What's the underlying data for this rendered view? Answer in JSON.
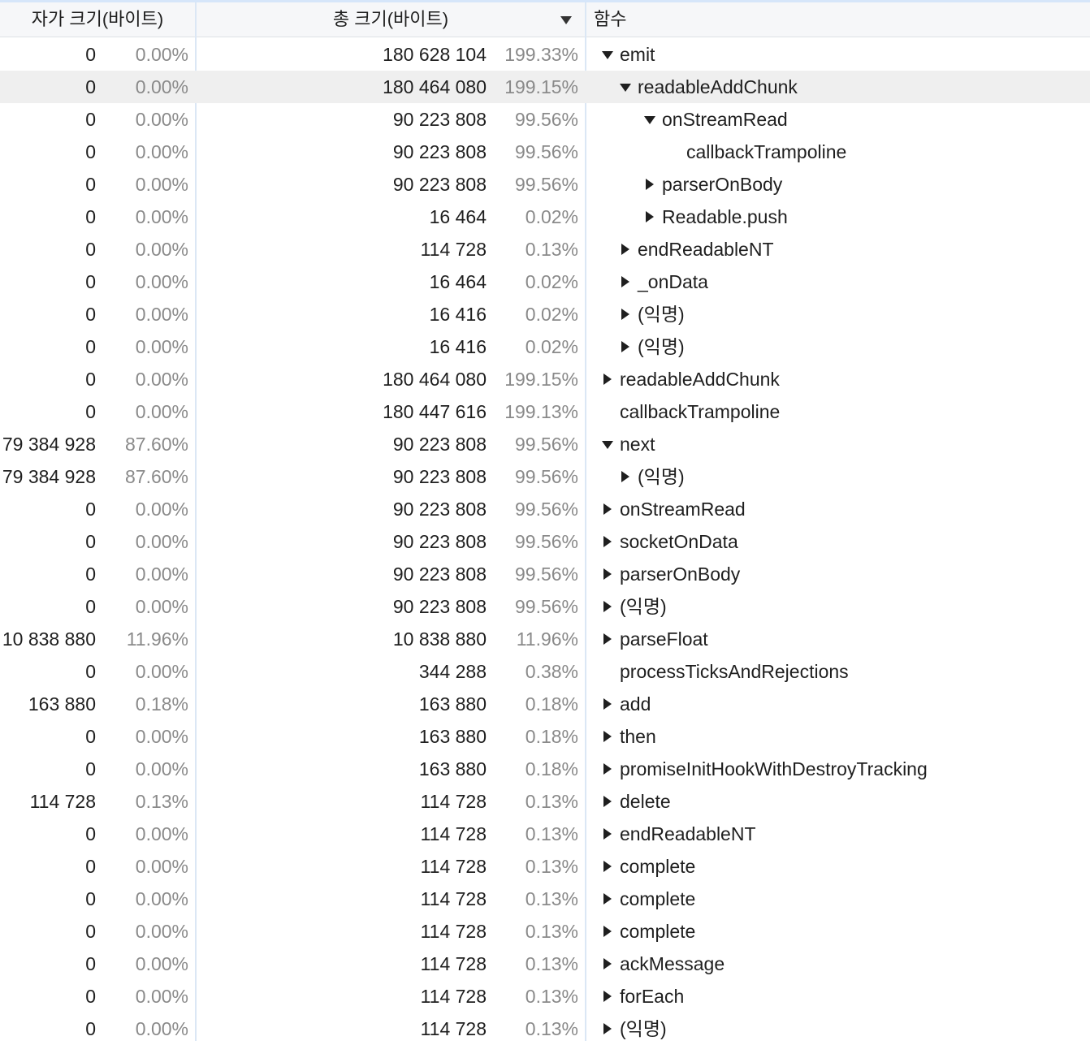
{
  "header": {
    "self_size": "자가 크기(바이트)",
    "total_size": "총 크기(바이트)",
    "function": "함수",
    "sort_icon": "sort-descending-icon"
  },
  "rows": [
    {
      "self": "0",
      "self_pct": "0.00%",
      "total": "180 628 104",
      "total_pct": "199.33%",
      "name": "emit",
      "depth": 0,
      "toggle": "open"
    },
    {
      "self": "0",
      "self_pct": "0.00%",
      "total": "180 464 080",
      "total_pct": "199.15%",
      "name": "readableAddChunk",
      "depth": 1,
      "toggle": "open",
      "selected": true
    },
    {
      "self": "0",
      "self_pct": "0.00%",
      "total": "90 223 808",
      "total_pct": "99.56%",
      "name": "onStreamRead",
      "depth": 2,
      "toggle": "open"
    },
    {
      "self": "0",
      "self_pct": "0.00%",
      "total": "90 223 808",
      "total_pct": "99.56%",
      "name": "callbackTrampoline",
      "depth": 3,
      "toggle": "none"
    },
    {
      "self": "0",
      "self_pct": "0.00%",
      "total": "90 223 808",
      "total_pct": "99.56%",
      "name": "parserOnBody",
      "depth": 2,
      "toggle": "closed"
    },
    {
      "self": "0",
      "self_pct": "0.00%",
      "total": "16 464",
      "total_pct": "0.02%",
      "name": "Readable.push",
      "depth": 2,
      "toggle": "closed"
    },
    {
      "self": "0",
      "self_pct": "0.00%",
      "total": "114 728",
      "total_pct": "0.13%",
      "name": "endReadableNT",
      "depth": 1,
      "toggle": "closed"
    },
    {
      "self": "0",
      "self_pct": "0.00%",
      "total": "16 464",
      "total_pct": "0.02%",
      "name": "_onData",
      "depth": 1,
      "toggle": "closed"
    },
    {
      "self": "0",
      "self_pct": "0.00%",
      "total": "16 416",
      "total_pct": "0.02%",
      "name": "(익명)",
      "depth": 1,
      "toggle": "closed"
    },
    {
      "self": "0",
      "self_pct": "0.00%",
      "total": "16 416",
      "total_pct": "0.02%",
      "name": "(익명)",
      "depth": 1,
      "toggle": "closed"
    },
    {
      "self": "0",
      "self_pct": "0.00%",
      "total": "180 464 080",
      "total_pct": "199.15%",
      "name": "readableAddChunk",
      "depth": 0,
      "toggle": "closed"
    },
    {
      "self": "0",
      "self_pct": "0.00%",
      "total": "180 447 616",
      "total_pct": "199.13%",
      "name": "callbackTrampoline",
      "depth": 0,
      "toggle": "none"
    },
    {
      "self": "79 384 928",
      "self_pct": "87.60%",
      "total": "90 223 808",
      "total_pct": "99.56%",
      "name": "next",
      "depth": 0,
      "toggle": "open"
    },
    {
      "self": "79 384 928",
      "self_pct": "87.60%",
      "total": "90 223 808",
      "total_pct": "99.56%",
      "name": "(익명)",
      "depth": 1,
      "toggle": "closed"
    },
    {
      "self": "0",
      "self_pct": "0.00%",
      "total": "90 223 808",
      "total_pct": "99.56%",
      "name": "onStreamRead",
      "depth": 0,
      "toggle": "closed"
    },
    {
      "self": "0",
      "self_pct": "0.00%",
      "total": "90 223 808",
      "total_pct": "99.56%",
      "name": "socketOnData",
      "depth": 0,
      "toggle": "closed"
    },
    {
      "self": "0",
      "self_pct": "0.00%",
      "total": "90 223 808",
      "total_pct": "99.56%",
      "name": "parserOnBody",
      "depth": 0,
      "toggle": "closed"
    },
    {
      "self": "0",
      "self_pct": "0.00%",
      "total": "90 223 808",
      "total_pct": "99.56%",
      "name": "(익명)",
      "depth": 0,
      "toggle": "closed"
    },
    {
      "self": "10 838 880",
      "self_pct": "11.96%",
      "total": "10 838 880",
      "total_pct": "11.96%",
      "name": "parseFloat",
      "depth": 0,
      "toggle": "closed"
    },
    {
      "self": "0",
      "self_pct": "0.00%",
      "total": "344 288",
      "total_pct": "0.38%",
      "name": "processTicksAndRejections",
      "depth": 0,
      "toggle": "none"
    },
    {
      "self": "163 880",
      "self_pct": "0.18%",
      "total": "163 880",
      "total_pct": "0.18%",
      "name": "add",
      "depth": 0,
      "toggle": "closed"
    },
    {
      "self": "0",
      "self_pct": "0.00%",
      "total": "163 880",
      "total_pct": "0.18%",
      "name": "then",
      "depth": 0,
      "toggle": "closed"
    },
    {
      "self": "0",
      "self_pct": "0.00%",
      "total": "163 880",
      "total_pct": "0.18%",
      "name": "promiseInitHookWithDestroyTracking",
      "depth": 0,
      "toggle": "closed"
    },
    {
      "self": "114 728",
      "self_pct": "0.13%",
      "total": "114 728",
      "total_pct": "0.13%",
      "name": "delete",
      "depth": 0,
      "toggle": "closed"
    },
    {
      "self": "0",
      "self_pct": "0.00%",
      "total": "114 728",
      "total_pct": "0.13%",
      "name": "endReadableNT",
      "depth": 0,
      "toggle": "closed"
    },
    {
      "self": "0",
      "self_pct": "0.00%",
      "total": "114 728",
      "total_pct": "0.13%",
      "name": "complete",
      "depth": 0,
      "toggle": "closed"
    },
    {
      "self": "0",
      "self_pct": "0.00%",
      "total": "114 728",
      "total_pct": "0.13%",
      "name": "complete",
      "depth": 0,
      "toggle": "closed"
    },
    {
      "self": "0",
      "self_pct": "0.00%",
      "total": "114 728",
      "total_pct": "0.13%",
      "name": "complete",
      "depth": 0,
      "toggle": "closed"
    },
    {
      "self": "0",
      "self_pct": "0.00%",
      "total": "114 728",
      "total_pct": "0.13%",
      "name": "ackMessage",
      "depth": 0,
      "toggle": "closed"
    },
    {
      "self": "0",
      "self_pct": "0.00%",
      "total": "114 728",
      "total_pct": "0.13%",
      "name": "forEach",
      "depth": 0,
      "toggle": "closed"
    },
    {
      "self": "0",
      "self_pct": "0.00%",
      "total": "114 728",
      "total_pct": "0.13%",
      "name": "(익명)",
      "depth": 0,
      "toggle": "closed"
    }
  ]
}
